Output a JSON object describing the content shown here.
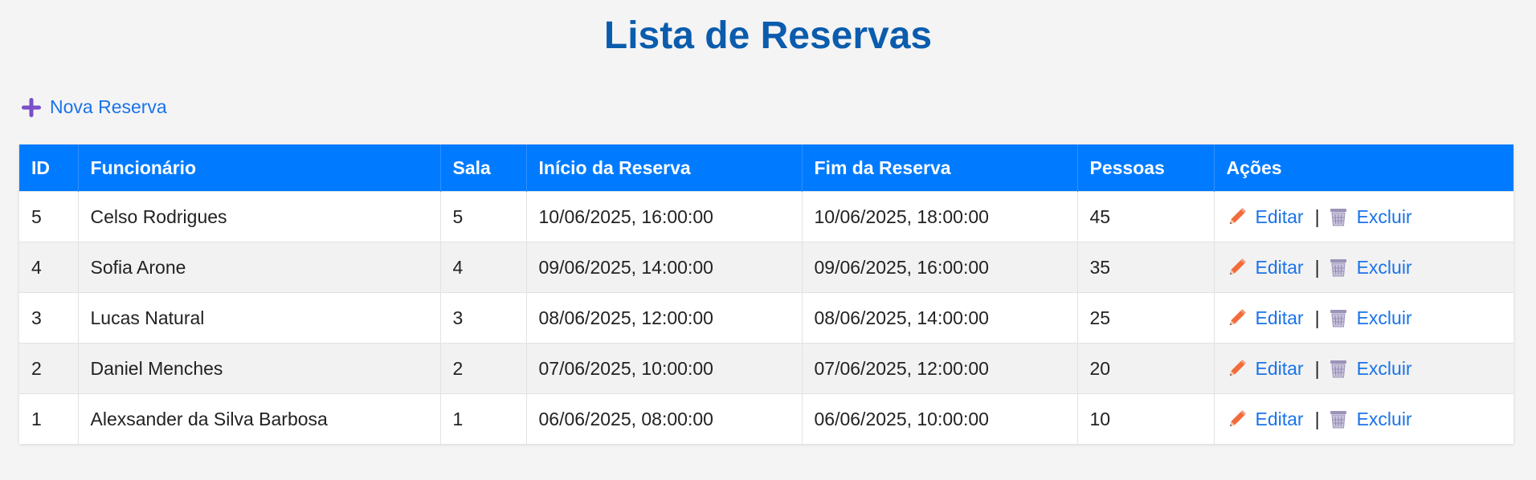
{
  "page": {
    "title": "Lista de Reservas"
  },
  "toolbar": {
    "new_label": "Nova Reserva"
  },
  "table": {
    "headers": [
      "ID",
      "Funcionário",
      "Sala",
      "Início da Reserva",
      "Fim da Reserva",
      "Pessoas",
      "Ações"
    ],
    "rows": [
      {
        "id": "5",
        "employee": "Celso Rodrigues",
        "room": "5",
        "start": "10/06/2025, 16:00:00",
        "end": "10/06/2025, 18:00:00",
        "people": "45"
      },
      {
        "id": "4",
        "employee": "Sofia Arone",
        "room": "4",
        "start": "09/06/2025, 14:00:00",
        "end": "09/06/2025, 16:00:00",
        "people": "35"
      },
      {
        "id": "3",
        "employee": "Lucas Natural",
        "room": "3",
        "start": "08/06/2025, 12:00:00",
        "end": "08/06/2025, 14:00:00",
        "people": "25"
      },
      {
        "id": "2",
        "employee": "Daniel Menches",
        "room": "2",
        "start": "07/06/2025, 10:00:00",
        "end": "07/06/2025, 12:00:00",
        "people": "20"
      },
      {
        "id": "1",
        "employee": "Alexsander da Silva Barbosa",
        "room": "1",
        "start": "06/06/2025, 08:00:00",
        "end": "06/06/2025, 10:00:00",
        "people": "10"
      }
    ],
    "actions": {
      "edit_label": "Editar",
      "separator": "|",
      "delete_label": "Excluir"
    }
  },
  "colors": {
    "title": "#0b5cad",
    "header_bg": "#007bff",
    "link": "#1a73e8",
    "row_alt": "#f2f2f2"
  },
  "icons": {
    "new": "plus-icon",
    "edit": "pencil-icon",
    "delete": "trash-icon"
  }
}
